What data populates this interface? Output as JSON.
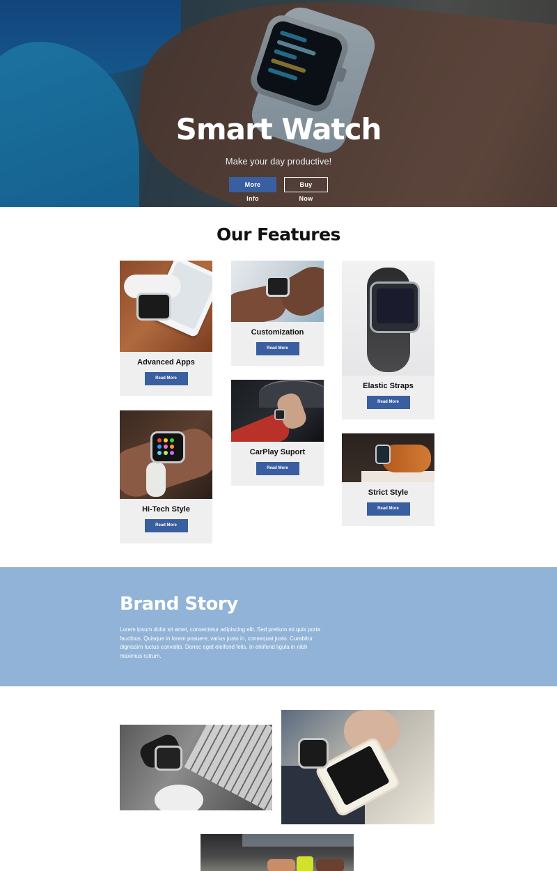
{
  "hero": {
    "title": "Smart Watch",
    "subtitle": "Make your day productive!",
    "primary_button": "More Info",
    "secondary_button": "Buy Now"
  },
  "features": {
    "title": "Our Features",
    "cards": [
      {
        "title": "Advanced Apps",
        "button": "Read More"
      },
      {
        "title": "Customization",
        "button": "Read More"
      },
      {
        "title": "Elastic Straps",
        "button": "Read More"
      },
      {
        "title": "Hi-Tech Style",
        "button": "Read More"
      },
      {
        "title": "CarPlay Suport",
        "button": "Read More"
      },
      {
        "title": "Strict Style",
        "button": "Read More"
      }
    ]
  },
  "brand": {
    "title": "Brand Story",
    "text": "Lorem ipsum dolor sit amet, consectetur adipiscing elit. Sed pretium mi quis porta faucibus. Quisque in lorem posuere, varius justo in, consequat justo. Curabitur dignissim luctus convallis. Donec eget eleifend felis. In eleifend ligula in nibh maximus rutrum."
  },
  "colors": {
    "accent": "#3a5fa0",
    "brand_band": "#91b3d7",
    "card_bg": "#efeff0"
  }
}
